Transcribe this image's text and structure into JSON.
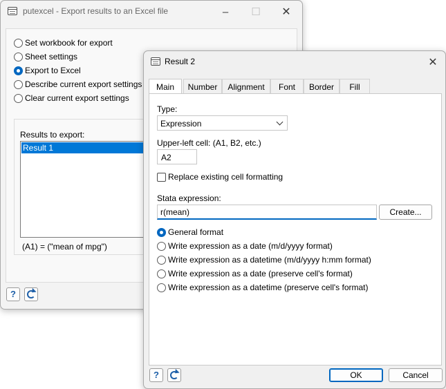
{
  "back_window": {
    "title": "putexcel - Export results to an Excel file",
    "options": [
      {
        "label": "Set workbook for export",
        "selected": false
      },
      {
        "label": "Sheet settings",
        "selected": false
      },
      {
        "label": "Export to Excel",
        "selected": true
      },
      {
        "label": "Describe current export settings",
        "selected": false
      },
      {
        "label": "Clear current export settings",
        "selected": false
      }
    ],
    "results_label": "Results to export:",
    "results_items": [
      "Result 1"
    ],
    "assignment_text": "(A1) = (\"mean of mpg\")"
  },
  "dialog": {
    "title": "Result 2",
    "tabs": [
      "Main",
      "Number",
      "Alignment",
      "Font",
      "Border",
      "Fill"
    ],
    "active_tab": "Main",
    "type_label": "Type:",
    "type_value": "Expression",
    "cell_label": "Upper-left cell: (A1, B2, etc.)",
    "cell_value": "A2",
    "replace_label": "Replace existing cell formatting",
    "replace_checked": false,
    "expr_label": "Stata expression:",
    "expr_value": "r(mean)",
    "create_label": "Create...",
    "formats": [
      {
        "label": "General format",
        "selected": true
      },
      {
        "label": "Write expression as a date (m/d/yyyy format)",
        "selected": false
      },
      {
        "label": "Write expression as a datetime (m/d/yyyy h:mm format)",
        "selected": false
      },
      {
        "label": "Write expression as a date (preserve cell's format)",
        "selected": false
      },
      {
        "label": "Write expression as a datetime (preserve cell's format)",
        "selected": false
      }
    ],
    "ok_label": "OK",
    "cancel_label": "Cancel"
  },
  "colors": {
    "accent": "#0067c0",
    "selection": "#0078d7"
  }
}
